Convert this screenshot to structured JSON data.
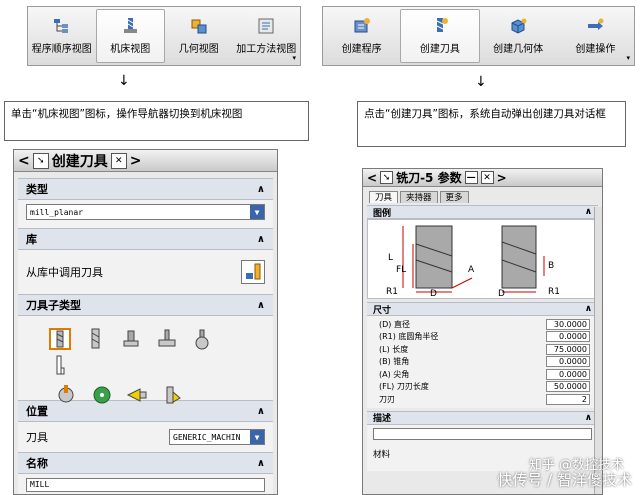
{
  "toolbar_left": {
    "buttons": [
      {
        "label": "程序顺序视图",
        "icon": "program-order-view-icon"
      },
      {
        "label": "机床视图",
        "icon": "machine-tool-view-icon",
        "active": true
      },
      {
        "label": "几何视图",
        "icon": "geometry-view-icon"
      },
      {
        "label": "加工方法视图",
        "icon": "machining-method-view-icon"
      }
    ],
    "more": "▾"
  },
  "toolbar_right": {
    "buttons": [
      {
        "label": "创建程序",
        "icon": "create-program-icon"
      },
      {
        "label": "创建刀具",
        "icon": "create-tool-icon",
        "active": true
      },
      {
        "label": "创建几何体",
        "icon": "create-geometry-icon"
      },
      {
        "label": "创建操作",
        "icon": "create-operation-icon"
      }
    ],
    "more": "▾"
  },
  "arrow_glyph": "↓",
  "notes": {
    "left": "单击“机床视图”图标，操作导航器切换到机床视图",
    "right": "点击“创建刀具”图标，系统自动弹出创建刀具对话框"
  },
  "dialog_left": {
    "title": "创建刀具",
    "nav_prev": "<",
    "nav_next": ">",
    "close": "✕",
    "sections": {
      "type": {
        "label": "类型",
        "value": "mill_planar"
      },
      "library": {
        "label": "库",
        "action_label": "从库中调用刀具"
      },
      "subtype": {
        "label": "刀具子类型"
      },
      "location": {
        "label": "位置",
        "tool_label": "刀具",
        "tool_value": "GENERIC_MACHIN"
      },
      "name": {
        "label": "名称",
        "value": "MILL"
      }
    },
    "collapse_glyph": "∧",
    "dropdown_glyph": "▼"
  },
  "dialog_right": {
    "title": "铣刀-5 参数",
    "title_minus": "—",
    "close": "✕",
    "nav_prev": "<",
    "nav_next": ">",
    "tabs": [
      "刀具",
      "夹持器",
      "更多"
    ],
    "legend_label": "图例",
    "dims_label": "尺寸",
    "dims": [
      {
        "label": "(D) 直径",
        "value": "30.0000"
      },
      {
        "label": "(R1) 底圆角半径",
        "value": "0.0000"
      },
      {
        "label": "(L) 长度",
        "value": "75.0000"
      },
      {
        "label": "(B) 锥角",
        "value": "0.0000"
      },
      {
        "label": "(A) 尖角",
        "value": "0.0000"
      },
      {
        "label": "(FL) 刀刃长度",
        "value": "50.0000"
      },
      {
        "label": "刀刃",
        "value": "2"
      }
    ],
    "desc_label": "描述",
    "material_label": "材料",
    "figure_labels": {
      "L": "L",
      "FL": "FL",
      "R1": "R1",
      "D": "D",
      "A": "A",
      "B": "B"
    }
  },
  "watermark": {
    "line1": "知乎 @数控技术",
    "line2": "快传号 / 智洋傻技术"
  }
}
